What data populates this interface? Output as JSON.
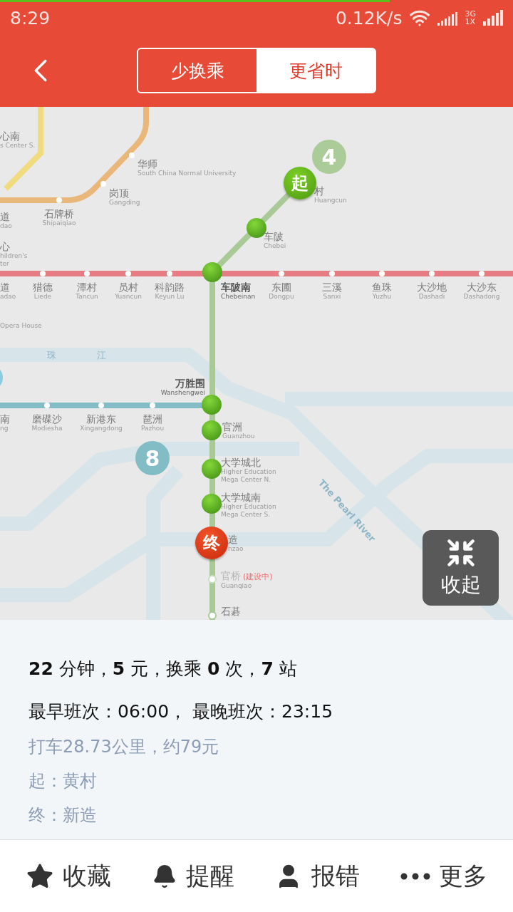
{
  "progress": {
    "level": 0.76
  },
  "status_bar": {
    "time": "8:29",
    "speed": "0.12K/s",
    "network_top": "3G",
    "network_bottom": "1X"
  },
  "tabs": [
    {
      "label": "少换乘",
      "selected": true
    },
    {
      "label": "更省时",
      "selected": false
    }
  ],
  "map": {
    "line_badges": [
      {
        "label": "4",
        "color": "#abcb98"
      },
      {
        "label": "8",
        "color": "#82bcc5"
      }
    ],
    "markers": [
      {
        "label": "起",
        "kind": "start"
      },
      {
        "label": "终",
        "kind": "end"
      }
    ],
    "labels": [
      {
        "kind": "station",
        "zh": "心南",
        "en": "s Center S."
      },
      {
        "kind": "station",
        "zh": "华师",
        "en": "South China Normal University"
      },
      {
        "kind": "station",
        "zh": "岗顶",
        "en": "Gangding"
      },
      {
        "kind": "station",
        "zh": "道",
        "en": "dao"
      },
      {
        "kind": "station",
        "zh": "石牌桥",
        "en": "Shipaiqiao"
      },
      {
        "kind": "station",
        "zh": "心",
        "en": "hildren's",
        "en2": "ter"
      },
      {
        "kind": "station",
        "zh": "道",
        "en": "adao"
      },
      {
        "kind": "station",
        "zh": "猎德",
        "en": "Liede"
      },
      {
        "kind": "station",
        "zh": "潭村",
        "en": "Tancun"
      },
      {
        "kind": "station",
        "zh": "员村",
        "en": "Yuancun"
      },
      {
        "kind": "station",
        "zh": "科韵路",
        "en": "Keyun Lu"
      },
      {
        "kind": "route",
        "zh": "车陂南",
        "en": "Chebeinan"
      },
      {
        "kind": "station",
        "zh": "东圃",
        "en": "Dongpu"
      },
      {
        "kind": "station",
        "zh": "三溪",
        "en": "Sanxi"
      },
      {
        "kind": "station",
        "zh": "鱼珠",
        "en": "Yuzhu"
      },
      {
        "kind": "station",
        "zh": "大沙地",
        "en": "Dashadi"
      },
      {
        "kind": "station",
        "zh": "大沙东",
        "en": "Dashadong"
      },
      {
        "kind": "station",
        "en": "Opera House"
      },
      {
        "kind": "station",
        "zh": "村",
        "en": "Huangcun"
      },
      {
        "kind": "station",
        "zh": "车陂",
        "en": "Chebei"
      },
      {
        "kind": "route",
        "zh": "万胜围",
        "en": "Wanshengwei"
      },
      {
        "kind": "station",
        "zh": "南",
        "en": "ng"
      },
      {
        "kind": "station",
        "zh": "磨碟沙",
        "en": "Modiesha"
      },
      {
        "kind": "station",
        "zh": "新港东",
        "en": "Xingangdong"
      },
      {
        "kind": "station",
        "zh": "琶洲",
        "en": "Pazhou"
      },
      {
        "kind": "station",
        "zh": "官洲",
        "en": "Guanzhou"
      },
      {
        "kind": "station",
        "zh": "大学城北",
        "en": "Higher Education",
        "en2": "Mega Center N."
      },
      {
        "kind": "station",
        "zh": "大学城南",
        "en": "Higher Education",
        "en2": "Mega Center S."
      },
      {
        "kind": "station",
        "zh": "造",
        "en": "nzao"
      },
      {
        "kind": "planned",
        "zh": "官桥",
        "note": "(建设中)",
        "en": "Guanqiao"
      },
      {
        "kind": "station",
        "zh": "石碁"
      }
    ],
    "river_labels": [
      "珠",
      "江",
      "The Pearl River"
    ],
    "collapse_button": "收起"
  },
  "summary": {
    "line1": "**22** 分钟，**5** 元，换乘 **0** 次，**7** 站",
    "line2": "最早班次：06:00， 最晚班次：23:15",
    "details": [
      "打车28.73公里，约79元",
      "起：黄村",
      "终：新造"
    ]
  },
  "actions": [
    {
      "kind": "star",
      "label": "收藏"
    },
    {
      "kind": "bell",
      "label": "提醒"
    },
    {
      "kind": "user",
      "label": "报错"
    },
    {
      "kind": "more",
      "label": "更多"
    }
  ]
}
